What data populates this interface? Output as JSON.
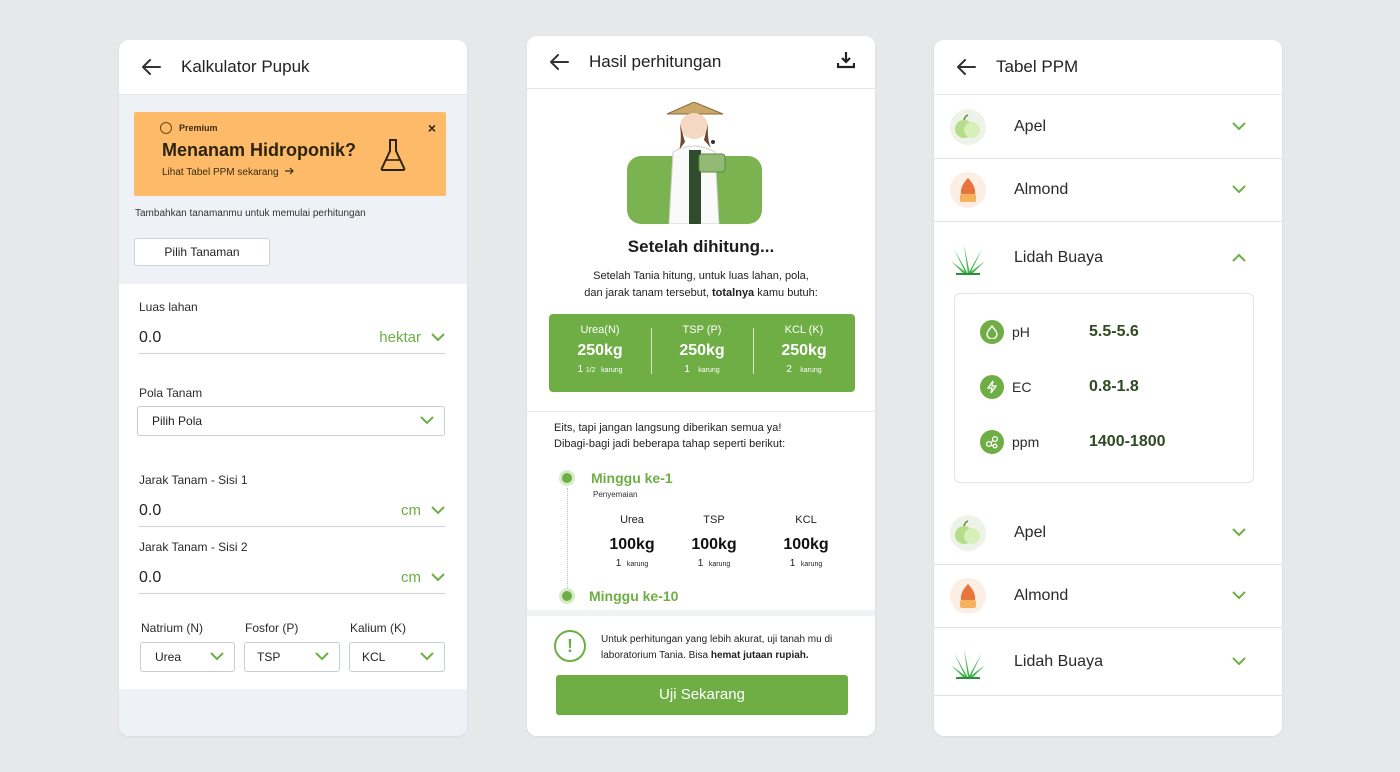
{
  "colors": {
    "accent": "#6eae45",
    "promo": "#fdbb6a",
    "background": "#e7e8ea"
  },
  "screen1": {
    "title": "Kalkulator Pupuk",
    "promo": {
      "badge": "Premium",
      "heading": "Menanam Hidroponik?",
      "link": "Lihat Tabel PPM sekarang",
      "close": "×"
    },
    "hint": "Tambahkan tanamanmu untuk memulai perhitungan",
    "pick_plant": "Pilih Tanaman",
    "luas": {
      "label": "Luas lahan",
      "value": "0.0",
      "unit": "hektar"
    },
    "pola": {
      "label": "Pola Tanam",
      "value": "Pilih Pola"
    },
    "jarak1": {
      "label": "Jarak Tanam - Sisi 1",
      "value": "0.0",
      "unit": "cm"
    },
    "jarak2": {
      "label": "Jarak Tanam - Sisi 2",
      "value": "0.0",
      "unit": "cm"
    },
    "nutrients": [
      {
        "label": "Natrium (N)",
        "value": "Urea"
      },
      {
        "label": "Fosfor (P)",
        "value": "TSP"
      },
      {
        "label": "Kalium (K)",
        "value": "KCL"
      }
    ]
  },
  "screen2": {
    "title": "Hasil perhitungan",
    "heading": "Setelah dihitung...",
    "desc_line1": "Setelah Tania hitung, untuk luas lahan, pola,",
    "desc_line2_a": "dan jarak tanam tersebut, ",
    "desc_line2_b": "totalnya",
    "desc_line2_c": " kamu butuh:",
    "totals": [
      {
        "name": "Urea(N)",
        "kg": "250kg",
        "sack_num": "1",
        "sack_frac": "1/2",
        "sack_unit": "karung"
      },
      {
        "name": "TSP (P)",
        "kg": "250kg",
        "sack_num": "1",
        "sack_frac": "",
        "sack_unit": "karung"
      },
      {
        "name": "KCL (K)",
        "kg": "250kg",
        "sack_num": "2",
        "sack_frac": "",
        "sack_unit": "karung"
      }
    ],
    "warn_line1": "Eits, tapi jangan langsung diberikan semua ya!",
    "warn_line2": "Dibagi-bagi jadi beberapa tahap seperti berikut:",
    "step1": {
      "title": "Minggu ke-1",
      "subtitle": "Penyemaian",
      "cols": [
        {
          "name": "Urea",
          "kg": "100kg",
          "sack_num": "1",
          "sack_unit": "karung"
        },
        {
          "name": "TSP",
          "kg": "100kg",
          "sack_num": "1",
          "sack_unit": "karung"
        },
        {
          "name": "KCL",
          "kg": "100kg",
          "sack_num": "1",
          "sack_unit": "karung"
        }
      ]
    },
    "step2": {
      "title": "Minggu ke-10"
    },
    "footer_note_a": "Untuk perhitungan yang lebih akurat, uji tanah mu di laboratorium Tania. Bisa ",
    "footer_note_b": "hemat jutaan rupiah.",
    "footer_icon": "!",
    "cta": "Uji Sekarang"
  },
  "screen3": {
    "title": "Tabel PPM",
    "items": [
      {
        "name": "Apel",
        "icon": "apple-icon"
      },
      {
        "name": "Almond",
        "icon": "almond-icon"
      },
      {
        "name": "Lidah Buaya",
        "icon": "aloe-icon"
      },
      {
        "name": "Apel",
        "icon": "apple-icon"
      },
      {
        "name": "Almond",
        "icon": "almond-icon"
      },
      {
        "name": "Lidah Buaya",
        "icon": "aloe-icon"
      }
    ],
    "detail": [
      {
        "label": "pH",
        "value": "5.5-5.6",
        "icon": "drop-icon"
      },
      {
        "label": "EC",
        "value": "0.8-1.8",
        "icon": "bolt-icon"
      },
      {
        "label": "ppm",
        "value": "1400-1800",
        "icon": "molecule-icon"
      }
    ]
  }
}
